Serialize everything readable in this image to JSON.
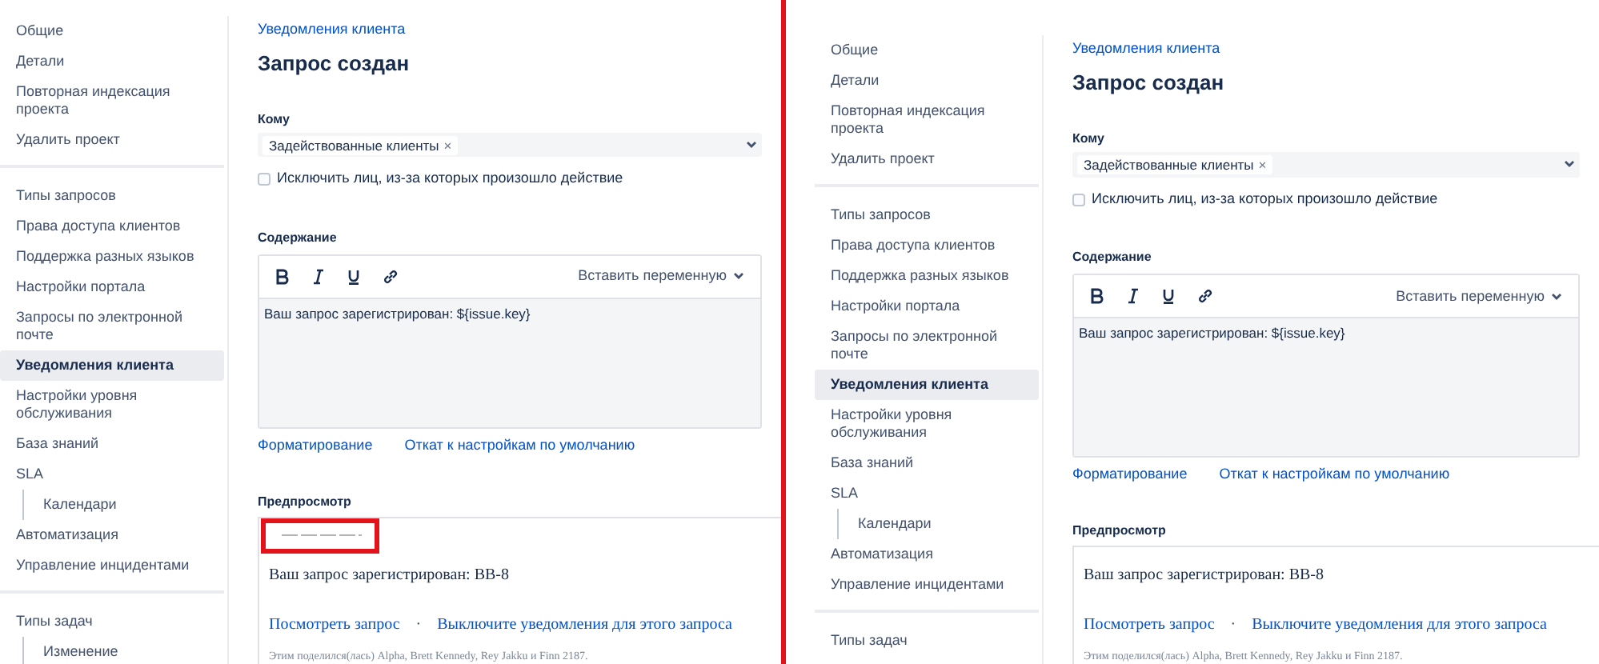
{
  "panels": [
    {
      "sidebar": {
        "groups": [
          {
            "items": [
              {
                "label": "Общие",
                "selected": false
              },
              {
                "label": "Детали",
                "selected": false
              },
              {
                "label": "Повторная индексация проекта",
                "selected": false
              },
              {
                "label": "Удалить проект",
                "selected": false
              }
            ]
          },
          {
            "items": [
              {
                "label": "Типы запросов",
                "selected": false
              },
              {
                "label": "Права доступа клиентов",
                "selected": false
              },
              {
                "label": "Поддержка разных языков",
                "selected": false
              },
              {
                "label": "Настройки портала",
                "selected": false
              },
              {
                "label": "Запросы по электронной почте",
                "selected": false
              },
              {
                "label": "Уведомления клиента",
                "selected": true
              },
              {
                "label": "Настройки уровня обслуживания",
                "selected": false
              },
              {
                "label": "База знаний",
                "selected": false
              },
              {
                "label": "SLA",
                "selected": false,
                "children": [
                  {
                    "label": "Календари",
                    "selected": false
                  }
                ]
              },
              {
                "label": "Автоматизация",
                "selected": false
              },
              {
                "label": "Управление инцидентами",
                "selected": false
              }
            ]
          },
          {
            "items": [
              {
                "label": "Типы задач",
                "selected": false,
                "children": [
                  {
                    "label": "Изменение",
                    "selected": false
                  }
                ]
              }
            ]
          }
        ]
      },
      "content": {
        "breadcrumb": "Уведомления клиента",
        "title": "Запрос создан",
        "recipients": {
          "label": "Кому",
          "chips": [
            "Задействованные клиенты"
          ],
          "remove_mark": "×"
        },
        "exclude_checkbox": {
          "label": "Исключить лиц, из-за которых произошло действие",
          "checked": false
        },
        "content_label": "Содержание",
        "editor": {
          "insert_variable": "Вставить переменную",
          "text": "Ваш запрос зарегистрирован: ${issue.key}"
        },
        "links": [
          "Форматирование",
          "Откат к настройкам по умолчанию"
        ],
        "preview": {
          "label": "Предпросмотр",
          "broken_image": {
            "highlighted": true
          },
          "heading": "Ваш запрос зарегистрирован: BB-8",
          "links": [
            "Посмотреть запрос",
            "Выключите уведомления для этого запроса"
          ],
          "separator": "·",
          "shared_with": "Этим поделился(лась) Alpha, Brett Kennedy, Rey Jakku и Finn 2187."
        }
      }
    },
    {
      "sidebar": {
        "groups": [
          {
            "items": [
              {
                "label": "Общие",
                "selected": false
              },
              {
                "label": "Детали",
                "selected": false
              },
              {
                "label": "Повторная индексация проекта",
                "selected": false
              },
              {
                "label": "Удалить проект",
                "selected": false
              }
            ]
          },
          {
            "items": [
              {
                "label": "Типы запросов",
                "selected": false
              },
              {
                "label": "Права доступа клиентов",
                "selected": false
              },
              {
                "label": "Поддержка разных языков",
                "selected": false
              },
              {
                "label": "Настройки портала",
                "selected": false
              },
              {
                "label": "Запросы по электронной почте",
                "selected": false
              },
              {
                "label": "Уведомления клиента",
                "selected": true
              },
              {
                "label": "Настройки уровня обслуживания",
                "selected": false
              },
              {
                "label": "База знаний",
                "selected": false
              },
              {
                "label": "SLA",
                "selected": false,
                "children": [
                  {
                    "label": "Календари",
                    "selected": false
                  }
                ]
              },
              {
                "label": "Автоматизация",
                "selected": false
              },
              {
                "label": "Управление инцидентами",
                "selected": false
              }
            ]
          },
          {
            "items": [
              {
                "label": "Типы задач",
                "selected": false
              }
            ]
          }
        ]
      },
      "content": {
        "breadcrumb": "Уведомления клиента",
        "title": "Запрос создан",
        "recipients": {
          "label": "Кому",
          "chips": [
            "Задействованные клиенты"
          ],
          "remove_mark": "×"
        },
        "exclude_checkbox": {
          "label": "Исключить лиц, из-за которых произошло действие",
          "checked": false
        },
        "content_label": "Содержание",
        "editor": {
          "insert_variable": "Вставить переменную",
          "text": "Ваш запрос зарегистрирован: ${issue.key}"
        },
        "links": [
          "Форматирование",
          "Откат к настройкам по умолчанию"
        ],
        "preview": {
          "label": "Предпросмотр",
          "heading": "Ваш запрос зарегистрирован: BB-8",
          "links": [
            "Посмотреть запрос",
            "Выключите уведомления для этого запроса"
          ],
          "separator": "·",
          "shared_with": "Этим поделился(лась) Alpha, Brett Kennedy, Rey Jakku и Finn 2187."
        }
      }
    }
  ]
}
